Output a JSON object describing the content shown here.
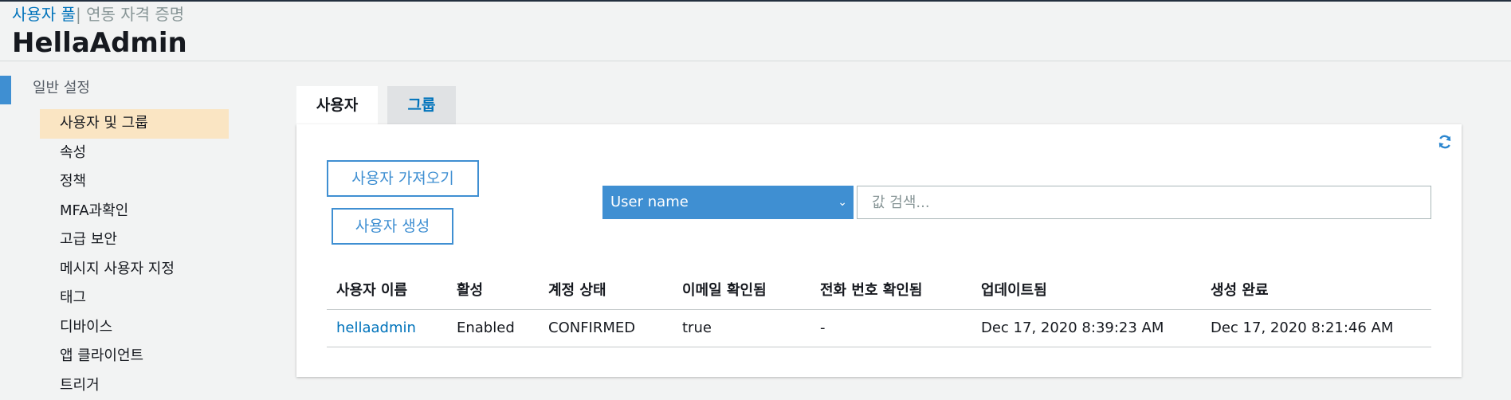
{
  "header": {
    "breadcrumb_link": "사용자 풀",
    "breadcrumb_separator": "|",
    "breadcrumb_current": " 연동 자격 증명",
    "title": "HellaAdmin"
  },
  "sidebar": {
    "section": "일반 설정",
    "items": [
      {
        "label": "사용자 및 그룹",
        "active": true
      },
      {
        "label": "속성"
      },
      {
        "label": "정책"
      },
      {
        "label": "MFA과확인"
      },
      {
        "label": "고급 보안"
      },
      {
        "label": "메시지 사용자 지정"
      },
      {
        "label": "태그"
      },
      {
        "label": "디바이스"
      },
      {
        "label": "앱 클라이언트"
      },
      {
        "label": "트리거"
      }
    ]
  },
  "tabs": {
    "users": "사용자",
    "groups": "그룹"
  },
  "panel": {
    "refresh_icon": "refresh-icon",
    "import_button": "사용자 가져오기",
    "create_button": "사용자 생성",
    "search_attribute": "User name",
    "search_placeholder": "값 검색..."
  },
  "table": {
    "columns": [
      "사용자 이름",
      "활성",
      "계정 상태",
      "이메일 확인됨",
      "전화 번호 확인됨",
      "업데이트됨",
      "생성 완료"
    ],
    "rows": [
      [
        "hellaadmin",
        "Enabled",
        "CONFIRMED",
        "true",
        "-",
        "Dec 17, 2020 8:39:23 AM",
        "Dec 17, 2020 8:21:46 AM"
      ]
    ]
  },
  "colors": {
    "accent_blue": "#3f8fd2",
    "link_blue": "#0073bb",
    "active_item_bg": "#fae5c3"
  }
}
